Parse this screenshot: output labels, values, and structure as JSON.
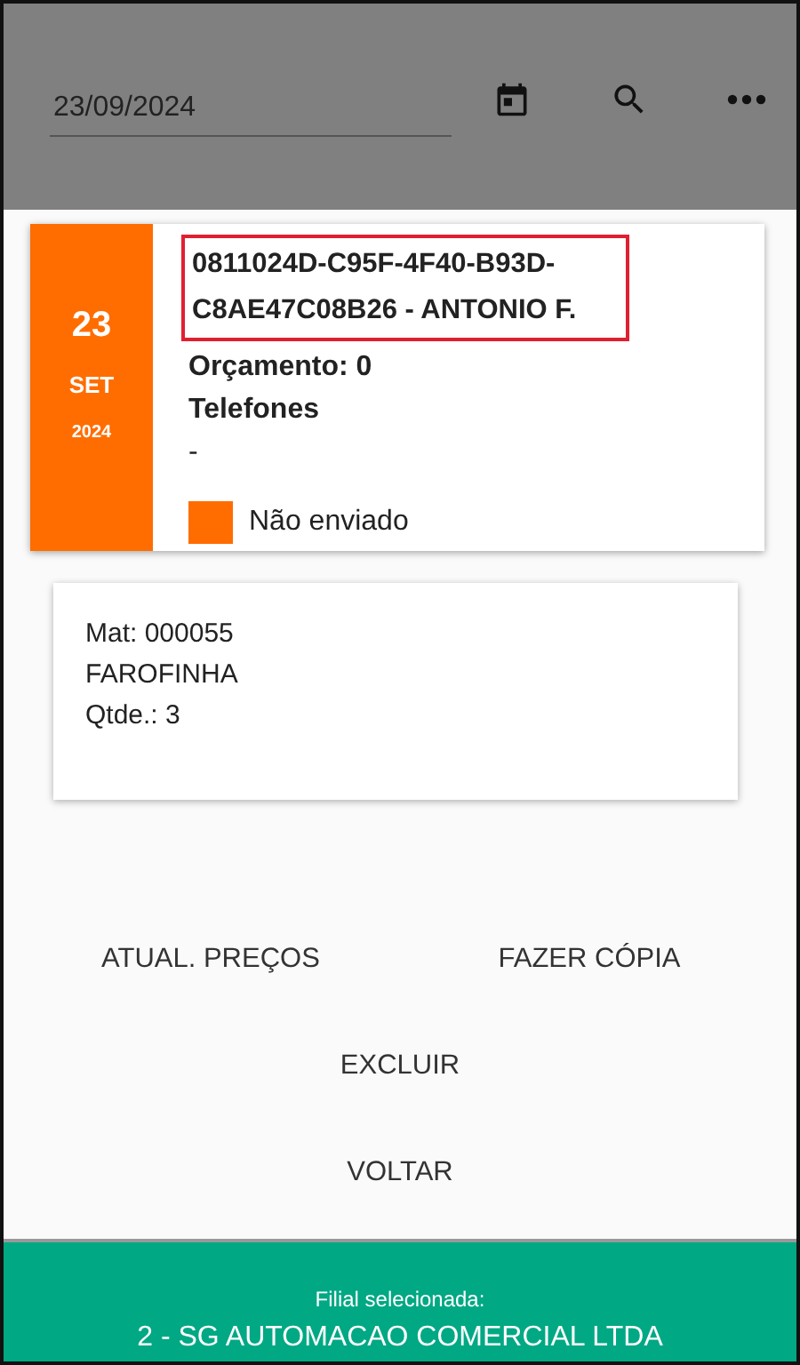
{
  "header": {
    "date_field": {
      "value": "23/09/2024"
    }
  },
  "order": {
    "day": "23",
    "month": "SET",
    "year": "2024",
    "title": "0811024D-C95F-4F40-B93D-C8AE47C08B26 - ANTONIO F.",
    "budget": "Orçamento: 0",
    "phones_label": "Telefones",
    "phones": "-",
    "status": {
      "label": "Não enviado",
      "color": "#ff6d00"
    }
  },
  "items": [
    {
      "lines": [
        "Mat: 000055",
        "FAROFINHA",
        "Qtde.: 3"
      ]
    }
  ],
  "actions": [
    "ATUAL. PREÇOS",
    "FAZER CÓPIA",
    "EXCLUIR",
    "VOLTAR"
  ],
  "footer": {
    "label": "Filial selecionada:",
    "branch": "2 - SG AUTOMACAO COMERCIAL LTDA"
  }
}
